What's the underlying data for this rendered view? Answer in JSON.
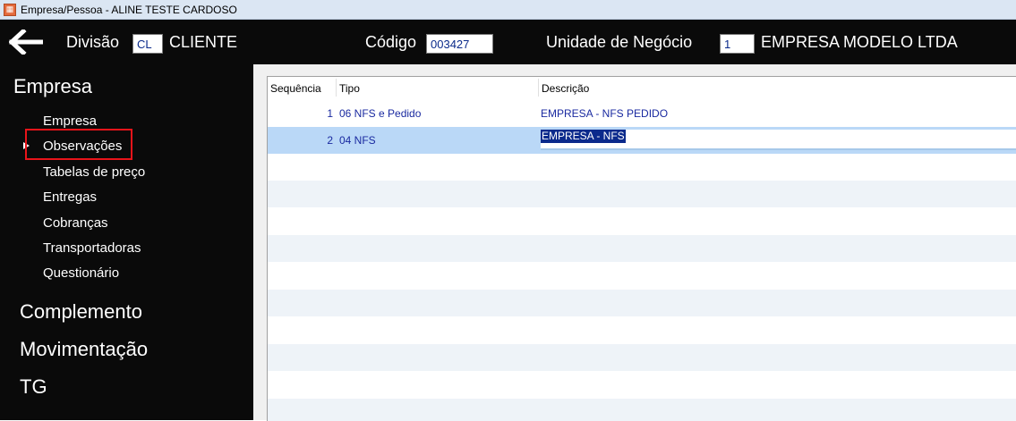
{
  "window": {
    "title": "Empresa/Pessoa - ALINE TESTE CARDOSO",
    "icon": "app-icon"
  },
  "header": {
    "divisao_label": "Divisão",
    "divisao_code": "CL",
    "divisao_name": "CLIENTE",
    "codigo_label": "Código",
    "codigo_value": "003427",
    "unidade_label": "Unidade de Negócio",
    "unidade_code": "1",
    "unidade_name": "EMPRESA MODELO LTDA"
  },
  "sidebar": {
    "sections": [
      {
        "title": "Empresa",
        "items": [
          "Empresa",
          "Observações",
          "Tabelas de preço",
          "Entregas",
          "Cobranças",
          "Transportadoras",
          "Questionário"
        ],
        "selected_index": 1
      },
      {
        "title": "Complemento"
      },
      {
        "title": "Movimentação"
      },
      {
        "title": "TG"
      }
    ]
  },
  "grid": {
    "columns": [
      "Sequência",
      "Tipo",
      "Descrição"
    ],
    "rows": [
      {
        "seq": "1",
        "tipo": "06 NFS e Pedido",
        "desc": "EMPRESA - NFS PEDIDO"
      },
      {
        "seq": "2",
        "tipo": "04 NFS",
        "desc": "EMPRESA - NFS"
      }
    ],
    "selected_row": 1
  },
  "colors": {
    "header_bg": "#0a0a0a",
    "selection_bg": "#bad8f7",
    "highlight_border": "#e8141a",
    "cell_text": "#1a2aa0"
  }
}
